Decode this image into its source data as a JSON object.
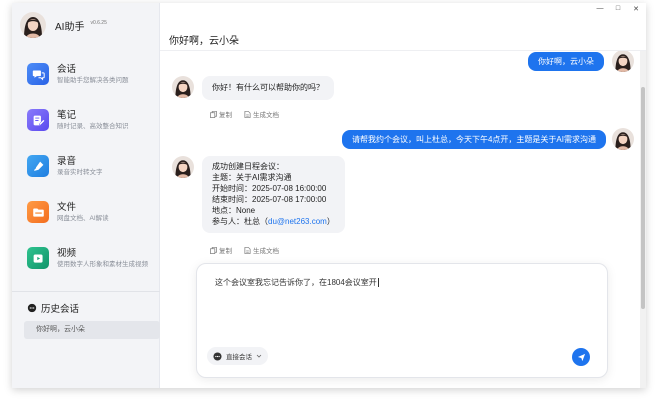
{
  "app": {
    "name": "AI助手",
    "version": "v0.6.25"
  },
  "window_controls": {
    "minimize": "—",
    "maximize": "□",
    "close": "✕"
  },
  "sidebar": {
    "items": [
      {
        "title": "会话",
        "desc": "智能助手您解决各类问题",
        "icon": "chat-bubbles-icon",
        "color": "#2f6ff2"
      },
      {
        "title": "笔记",
        "desc": "随时记录、高效整合知识",
        "icon": "note-pen-icon",
        "color": "#6a5af9"
      },
      {
        "title": "录音",
        "desc": "录音实时转文字",
        "icon": "microphone-icon",
        "color": "#2a8fe8"
      },
      {
        "title": "文件",
        "desc": "网盘文档、AI解读",
        "icon": "folder-icon",
        "color": "#f5822a"
      },
      {
        "title": "视频",
        "desc": "使用数字人形象和素材生成视频",
        "icon": "video-play-icon",
        "color": "#1aa87a"
      }
    ],
    "history": {
      "title": "历史会话",
      "items": [
        "你好啊，云小朵"
      ]
    }
  },
  "chat": {
    "title": "你好啊，云小朵",
    "messages": [
      {
        "role": "user",
        "text": "你好啊，云小朵"
      },
      {
        "role": "ai",
        "text": "你好！有什么可以帮助你的吗？"
      },
      {
        "role": "user",
        "text": "请帮我约个会议，叫上杜总，今天下午4点开，主题是关于AI需求沟通"
      },
      {
        "role": "ai",
        "lines": [
          "成功创建日程会议：",
          "主题：关于AI需求沟通",
          "开始时间：2025-07-08 16:00:00",
          "结束时间：2025-07-08 17:00:00",
          "地点：None"
        ],
        "attendee_prefix": "参与人：杜总（",
        "attendee_email": "du@net263.com",
        "attendee_suffix": "）"
      }
    ],
    "actions": {
      "copy": "复制",
      "generate_doc": "生成文档"
    }
  },
  "composer": {
    "value": "这个会议室我忘记告诉你了，在1804会议室开",
    "mode_label": "直接会话"
  },
  "colors": {
    "accent": "#1e74ee",
    "sidebar_bg": "#f3f4f7",
    "bubble_ai": "#f2f3f6"
  }
}
